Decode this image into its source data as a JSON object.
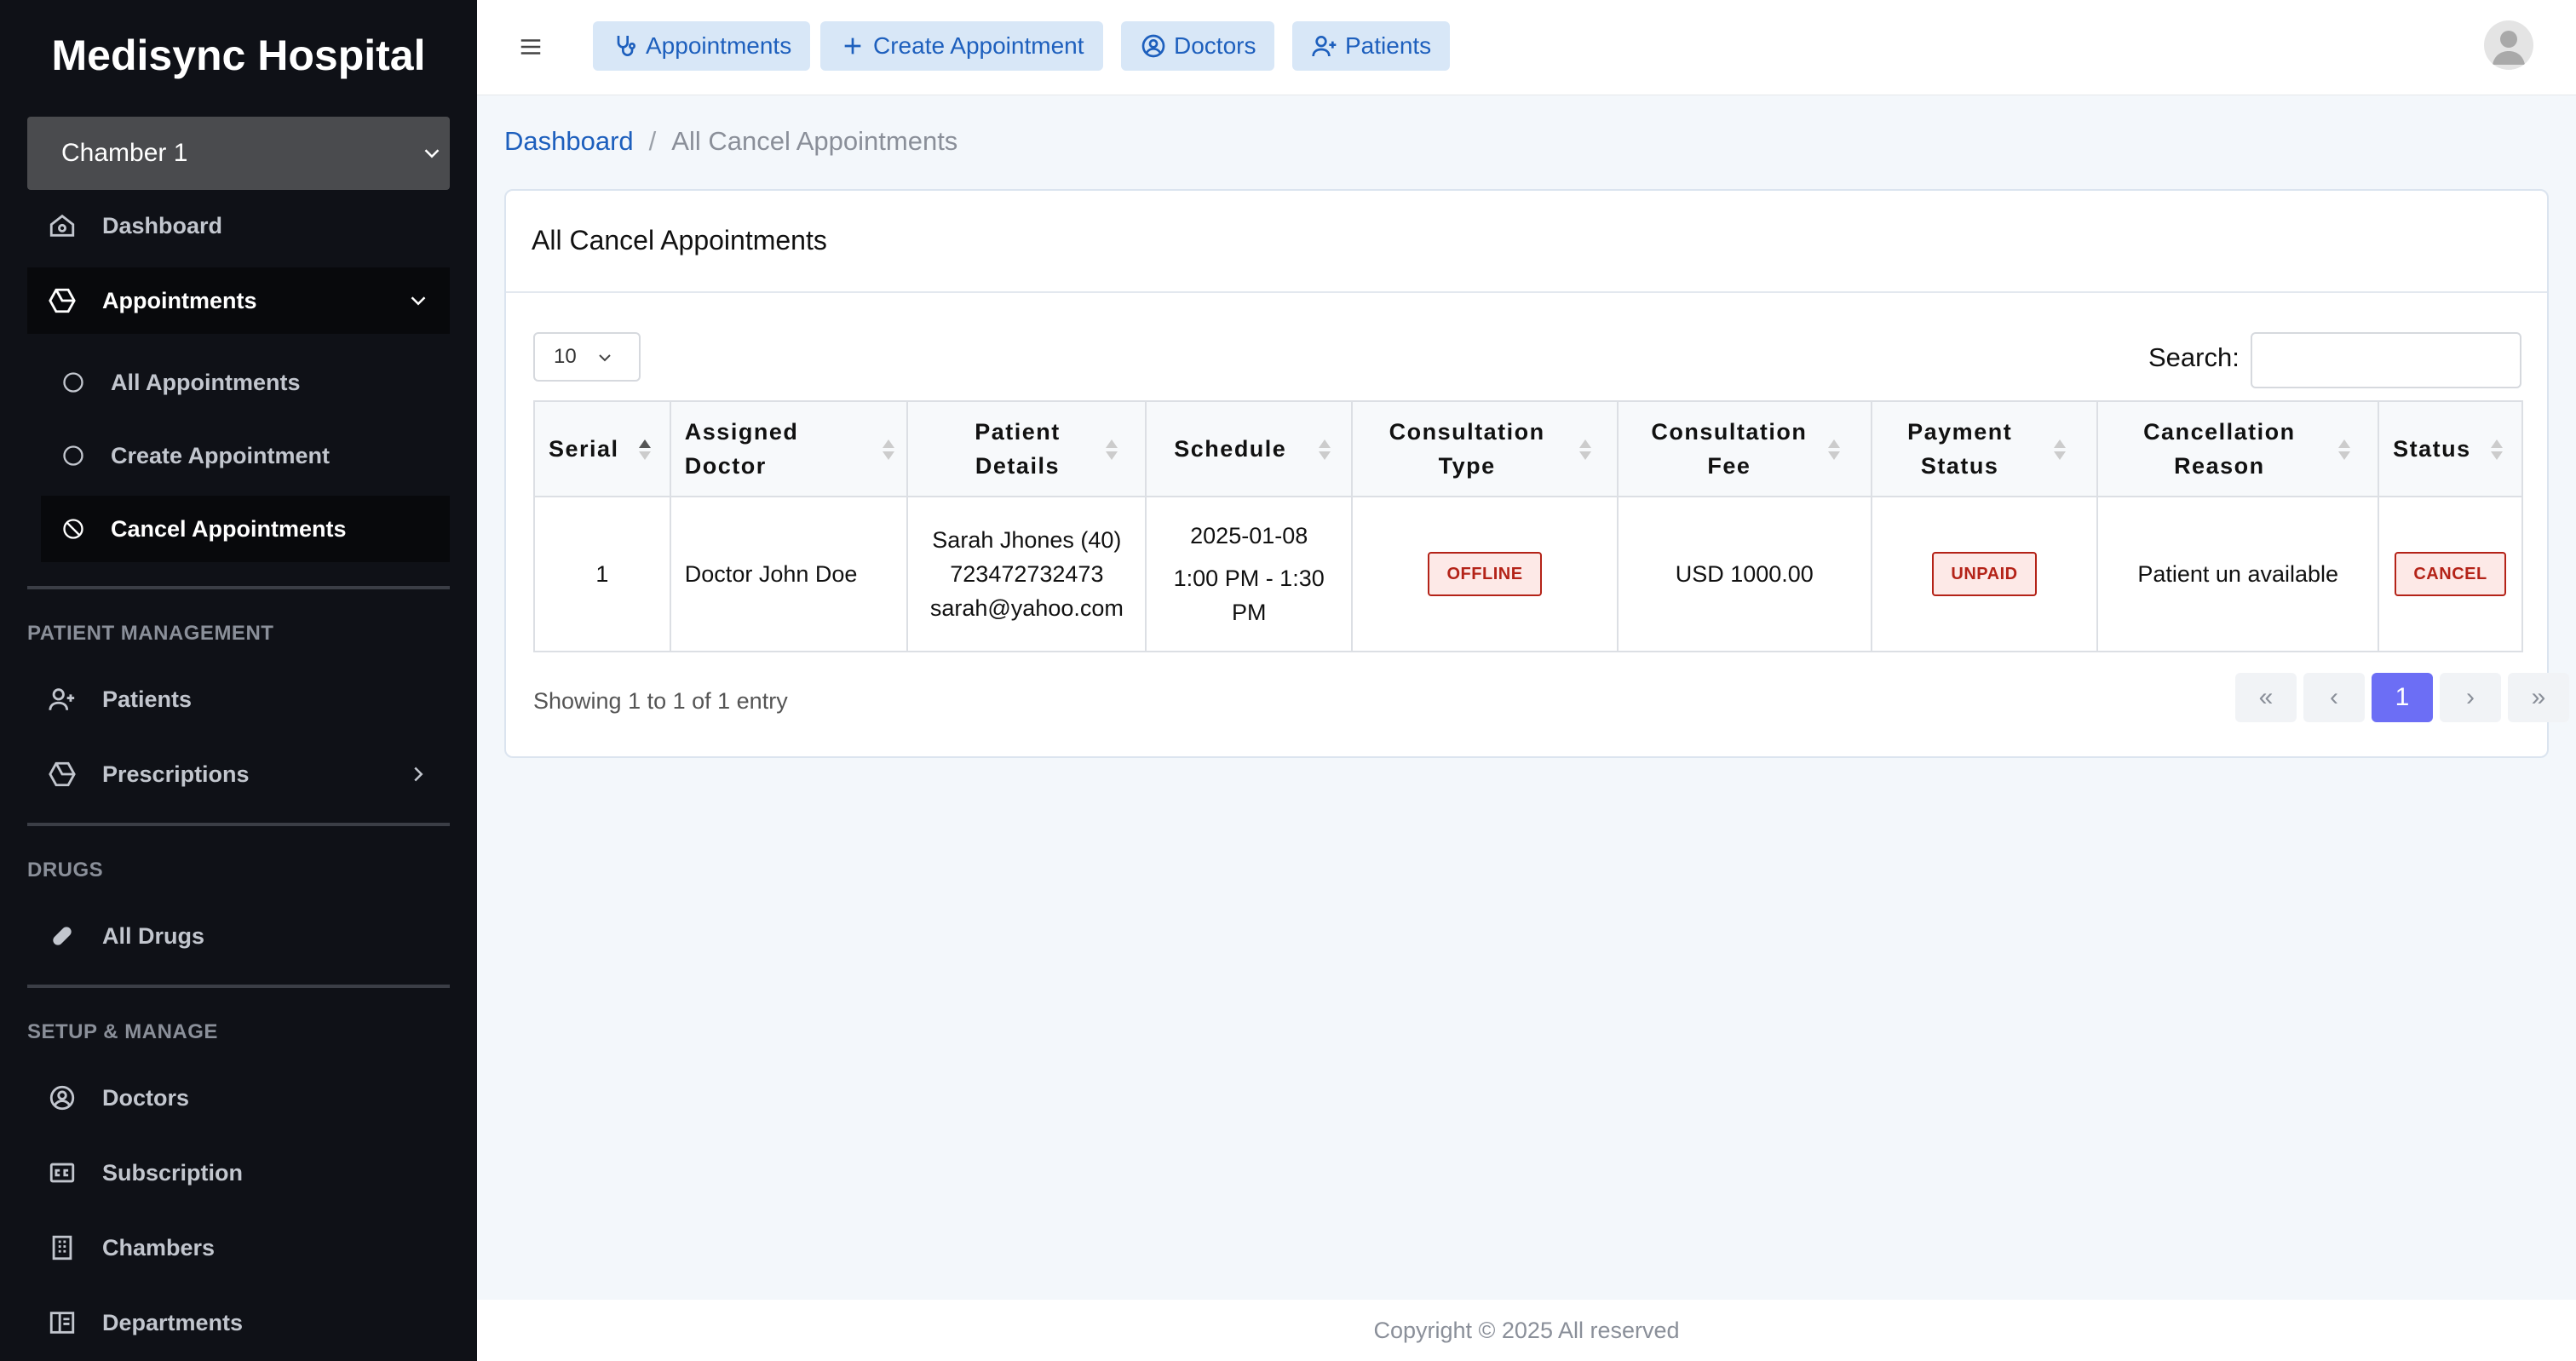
{
  "sidebar": {
    "brand": "Medisync Hospital",
    "chamber": "Chamber 1",
    "dashboard": "Dashboard",
    "appointments": "Appointments",
    "sub": {
      "all": "All Appointments",
      "create": "Create Appointment",
      "cancel": "Cancel Appointments"
    },
    "sections": {
      "patient_management": "PATIENT MANAGEMENT",
      "drugs": "DRUGS",
      "setup": "SETUP & MANAGE"
    },
    "patients": "Patients",
    "prescriptions": "Prescriptions",
    "all_drugs": "All Drugs",
    "doctors": "Doctors",
    "subscription": "Subscription",
    "chambers": "Chambers",
    "departments": "Departments"
  },
  "topbar": {
    "appointments": "Appointments",
    "create": "Create Appointment",
    "doctors": "Doctors",
    "patients": "Patients"
  },
  "breadcrumb": {
    "root": "Dashboard",
    "sep": "/",
    "current": "All Cancel Appointments"
  },
  "card": {
    "title": "All Cancel Appointments",
    "page_length": "10",
    "search_label": "Search:",
    "search_value": "",
    "info": "Showing 1 to 1 of 1 entry"
  },
  "table": {
    "headers": [
      "Serial",
      "Assigned Doctor",
      "Patient Details",
      "Schedule",
      "Consultation Type",
      "Consultation Fee",
      "Payment Status",
      "Cancellation Reason",
      "Status"
    ],
    "rows": [
      {
        "serial": "1",
        "doctor": "Doctor John Doe",
        "patient_name": "Sarah Jhones (40)",
        "patient_phone": "723472732473",
        "patient_email": "sarah@yahoo.com",
        "date": "2025-01-08",
        "time": "1:00 PM - 1:30 PM",
        "type": "OFFLINE",
        "fee": "USD 1000.00",
        "payment": "UNPAID",
        "reason": "Patient un available",
        "status": "CANCEL"
      }
    ]
  },
  "pager": {
    "first": "«",
    "prev": "‹",
    "page": "1",
    "next": "›",
    "last": "»"
  },
  "footer": "Copyright © 2025 All reserved",
  "colors": {
    "sidebar_bg": "#0f1117",
    "accent": "#1d5fbd",
    "pager_active": "#6c6ef5",
    "badge_red": "#b42318"
  }
}
